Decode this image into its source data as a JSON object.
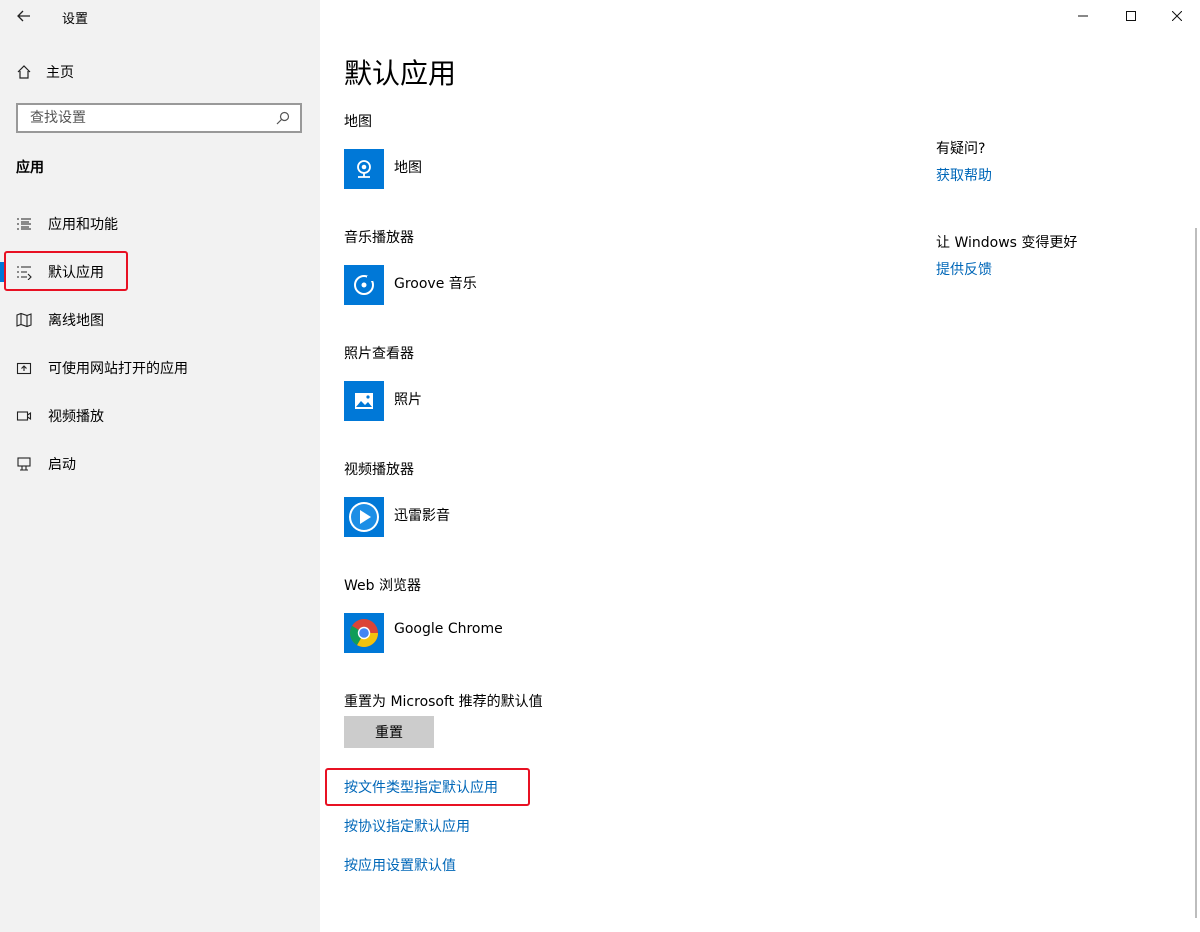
{
  "window": {
    "title": "设置",
    "back_icon": "arrow-left-icon",
    "minimize_icon": "minimize-icon",
    "maximize_icon": "maximize-icon",
    "close_icon": "close-icon"
  },
  "sidebar": {
    "home_label": "主页",
    "search_placeholder": "查找设置",
    "section_label": "应用",
    "items": [
      {
        "label": "应用和功能",
        "icon": "apps-features-icon"
      },
      {
        "label": "默认应用",
        "icon": "default-apps-icon",
        "selected": true
      },
      {
        "label": "离线地图",
        "icon": "offline-maps-icon"
      },
      {
        "label": "可使用网站打开的应用",
        "icon": "apps-for-websites-icon"
      },
      {
        "label": "视频播放",
        "icon": "video-playback-icon"
      },
      {
        "label": "启动",
        "icon": "startup-icon"
      }
    ]
  },
  "main": {
    "page_title": "默认应用",
    "categories": [
      {
        "label": "地图",
        "app": "地图",
        "icon": "maps-app-icon"
      },
      {
        "label": "音乐播放器",
        "app": "Groove 音乐",
        "icon": "groove-music-icon"
      },
      {
        "label": "照片查看器",
        "app": "照片",
        "icon": "photos-app-icon"
      },
      {
        "label": "视频播放器",
        "app": "迅雷影音",
        "icon": "xunlei-player-icon"
      },
      {
        "label": "Web 浏览器",
        "app": "Google Chrome",
        "icon": "chrome-icon"
      }
    ],
    "reset_label": "重置为 Microsoft 推荐的默认值",
    "reset_button": "重置",
    "links": [
      "按文件类型指定默认应用",
      "按协议指定默认应用",
      "按应用设置默认值"
    ]
  },
  "help": {
    "question": "有疑问?",
    "get_help": "获取帮助",
    "improve": "让 Windows 变得更好",
    "feedback": "提供反馈"
  },
  "colors": {
    "accent": "#0078d7",
    "link": "#0067b8",
    "highlight_box": "#e81123",
    "sidebar_bg": "#f2f2f2"
  }
}
